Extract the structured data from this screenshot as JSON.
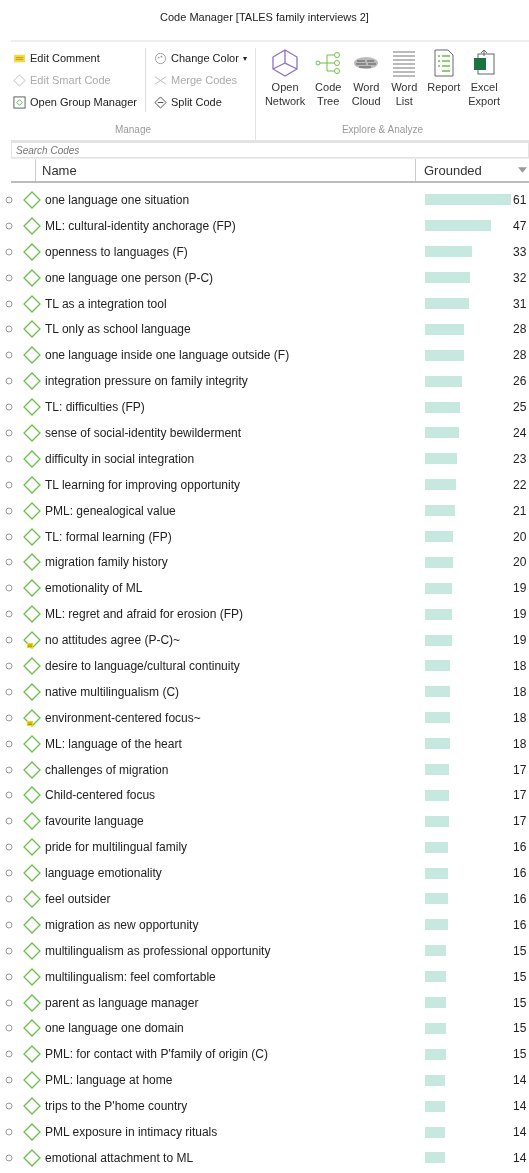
{
  "window": {
    "title": "Code Manager [TALES family interviews 2]"
  },
  "ribbon": {
    "manage": {
      "label": "Manage",
      "items": [
        {
          "label": "Edit Comment",
          "kind": "comment",
          "disabled": false
        },
        {
          "label": "Edit Smart Code",
          "kind": "smart",
          "disabled": true
        },
        {
          "label": "Open Group Manager",
          "kind": "group",
          "disabled": false
        },
        {
          "label": "Change Color",
          "kind": "color",
          "disabled": false,
          "caret": "▾"
        },
        {
          "label": "Merge Codes",
          "kind": "merge",
          "disabled": true
        },
        {
          "label": "Split Code",
          "kind": "split",
          "disabled": false
        }
      ]
    },
    "explore": {
      "label": "Explore & Analyze",
      "items": [
        {
          "lines": [
            "Open",
            "Network"
          ],
          "kind": "network"
        },
        {
          "lines": [
            "Code",
            "Tree"
          ],
          "kind": "tree"
        },
        {
          "lines": [
            "Word",
            "Cloud"
          ],
          "kind": "cloud"
        },
        {
          "lines": [
            "Word",
            "List"
          ],
          "kind": "list"
        },
        {
          "lines": [
            "Report"
          ],
          "kind": "report"
        },
        {
          "lines": [
            "Excel",
            "Export"
          ],
          "kind": "excel"
        }
      ]
    }
  },
  "search": {
    "placeholder": "Search Codes"
  },
  "table": {
    "columns": [
      "Name",
      "Grounded"
    ],
    "rows": [
      {
        "name": "one language one situation",
        "grounded": "61",
        "commented": false
      },
      {
        "name": "ML: cultural-identity anchorage (FP)",
        "grounded": "47",
        "commented": false
      },
      {
        "name": "openness to languages (F)",
        "grounded": "33",
        "commented": false
      },
      {
        "name": "one language one person (P-C)",
        "grounded": "32",
        "commented": false
      },
      {
        "name": "TL as a integration tool",
        "grounded": "31",
        "commented": false
      },
      {
        "name": "TL only as school language",
        "grounded": "28",
        "commented": false
      },
      {
        "name": "one language inside one language outside (F)",
        "grounded": "28",
        "commented": false
      },
      {
        "name": "integration pressure on family integrity",
        "grounded": "26",
        "commented": false
      },
      {
        "name": "TL: difficulties (FP)",
        "grounded": "25",
        "commented": false
      },
      {
        "name": "sense of social-identity bewilderment",
        "grounded": "24",
        "commented": false
      },
      {
        "name": "difficulty in social integration",
        "grounded": "23",
        "commented": false
      },
      {
        "name": "TL learning for improving opportunity",
        "grounded": "22",
        "commented": false
      },
      {
        "name": "PML: genealogical value",
        "grounded": "21",
        "commented": false
      },
      {
        "name": "TL: formal learning (FP)",
        "grounded": "20",
        "commented": false
      },
      {
        "name": "migration family history",
        "grounded": "20",
        "commented": false
      },
      {
        "name": "emotionality of ML",
        "grounded": "19",
        "commented": false
      },
      {
        "name": "ML: regret and afraid for erosion (FP)",
        "grounded": "19",
        "commented": false
      },
      {
        "name": "no attitudes agree (P-C)~",
        "grounded": "19",
        "commented": true
      },
      {
        "name": "desire to language/cultural continuity",
        "grounded": "18",
        "commented": false
      },
      {
        "name": "native multilingualism (C)",
        "grounded": "18",
        "commented": false
      },
      {
        "name": "environment-centered focus~",
        "grounded": "18",
        "commented": true
      },
      {
        "name": "ML: language of the heart",
        "grounded": "18",
        "commented": false
      },
      {
        "name": "challenges of migration",
        "grounded": "17",
        "commented": false
      },
      {
        "name": "Child-centered focus",
        "grounded": "17",
        "commented": false
      },
      {
        "name": "favourite language",
        "grounded": "17",
        "commented": false
      },
      {
        "name": "pride for multilingual family",
        "grounded": "16",
        "commented": false
      },
      {
        "name": "language emotionality",
        "grounded": "16",
        "commented": false
      },
      {
        "name": "feel outsider",
        "grounded": "16",
        "commented": false
      },
      {
        "name": "migration as new opportunity",
        "grounded": "16",
        "commented": false
      },
      {
        "name": "multilingualism as professional opportunity",
        "grounded": "15",
        "commented": false
      },
      {
        "name": "multilingualism: feel comfortable",
        "grounded": "15",
        "commented": false
      },
      {
        "name": "parent as language manager",
        "grounded": "15",
        "commented": false
      },
      {
        "name": "one language one domain",
        "grounded": "15",
        "commented": false
      },
      {
        "name": "PML: for contact with P'family of origin (C)",
        "grounded": "15",
        "commented": false
      },
      {
        "name": "PML: language at home",
        "grounded": "14",
        "commented": false
      },
      {
        "name": "trips to the P'home country",
        "grounded": "14",
        "commented": false
      },
      {
        "name": "PML exposure in intimacy rituals",
        "grounded": "14",
        "commented": false
      },
      {
        "name": "emotional attachment to ML",
        "grounded": "14",
        "commented": false
      }
    ]
  }
}
